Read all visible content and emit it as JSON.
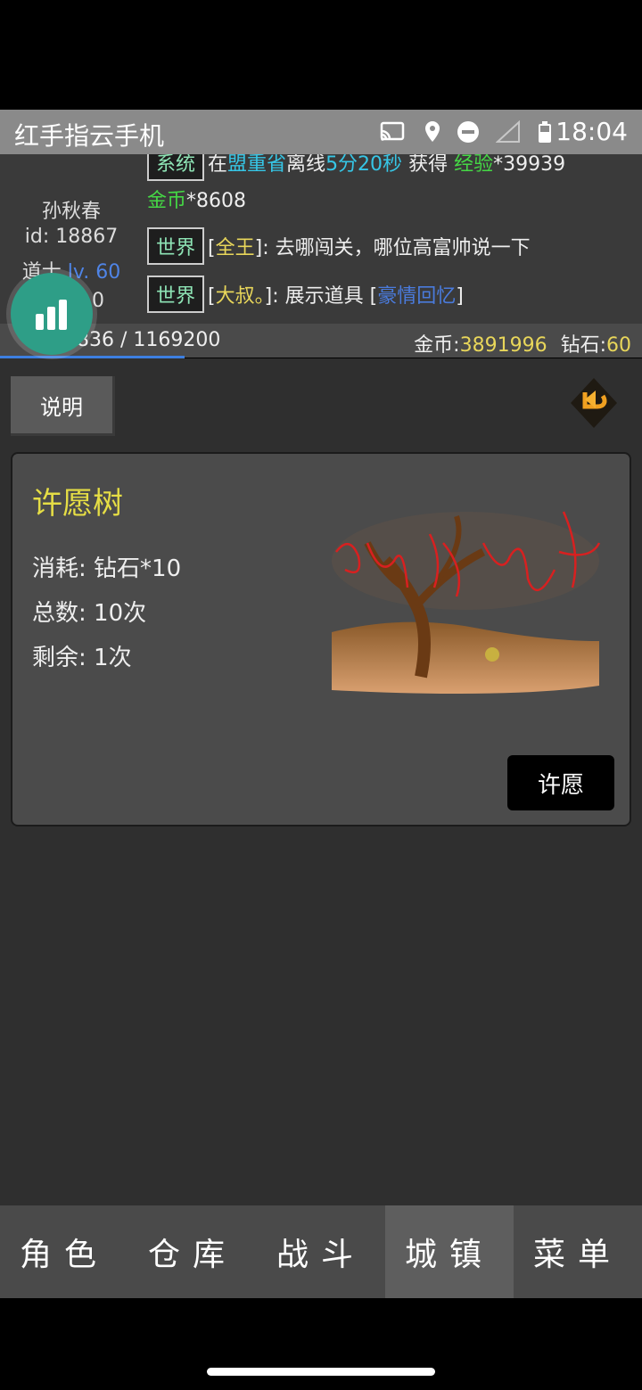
{
  "status_bar": {
    "app_title": "红手指云手机",
    "time": "18:04",
    "icons": [
      "cast-icon",
      "location-icon",
      "dnd-icon",
      "signal-icon",
      "battery-icon"
    ]
  },
  "player": {
    "name": "孙秋春",
    "id": "id: 18867",
    "class": "道士",
    "level": "lv. 60",
    "extra": "0"
  },
  "chat": [
    {
      "channel": "系统",
      "text_prefix": "在",
      "place": "盟重省",
      "mid": "离线",
      "duration": "5分20秒",
      "mid2": "获得",
      "reward1": "经验",
      "reward1_val": "*39939",
      "reward2": "金币",
      "reward2_val": "*8608"
    },
    {
      "channel": "世界",
      "speaker": "全王",
      "message": ": 去哪闯关，哪位高富帅说一下"
    },
    {
      "channel": "世界",
      "speaker": "大叔。",
      "message": ": 展示道具 [",
      "item": "豪情回忆",
      "close": "]"
    }
  ],
  "resources": {
    "exp": "836 / 1169200",
    "gold_label": "金币:",
    "gold_value": "3891996",
    "diamond_label": "钻石:",
    "diamond_value": "60",
    "progress_fraction": 0.0007
  },
  "toolbar": {
    "help_label": "说明",
    "back_icon": "back-arrow-icon"
  },
  "wish_tree": {
    "title": "许愿树",
    "cost": "消耗: 钻石*10",
    "total": "总数: 10次",
    "remaining": "剩余: 1次",
    "button_label": "许愿"
  },
  "nav": {
    "items": [
      "角色",
      "仓库",
      "战斗",
      "城镇",
      "菜单"
    ],
    "active_index": 3
  },
  "colors": {
    "accent_yellow": "#e5dd45",
    "channel_green": "#8ee4b5",
    "cyan": "#36c6e6",
    "green": "#45d845",
    "float_teal": "#2e9e87"
  }
}
